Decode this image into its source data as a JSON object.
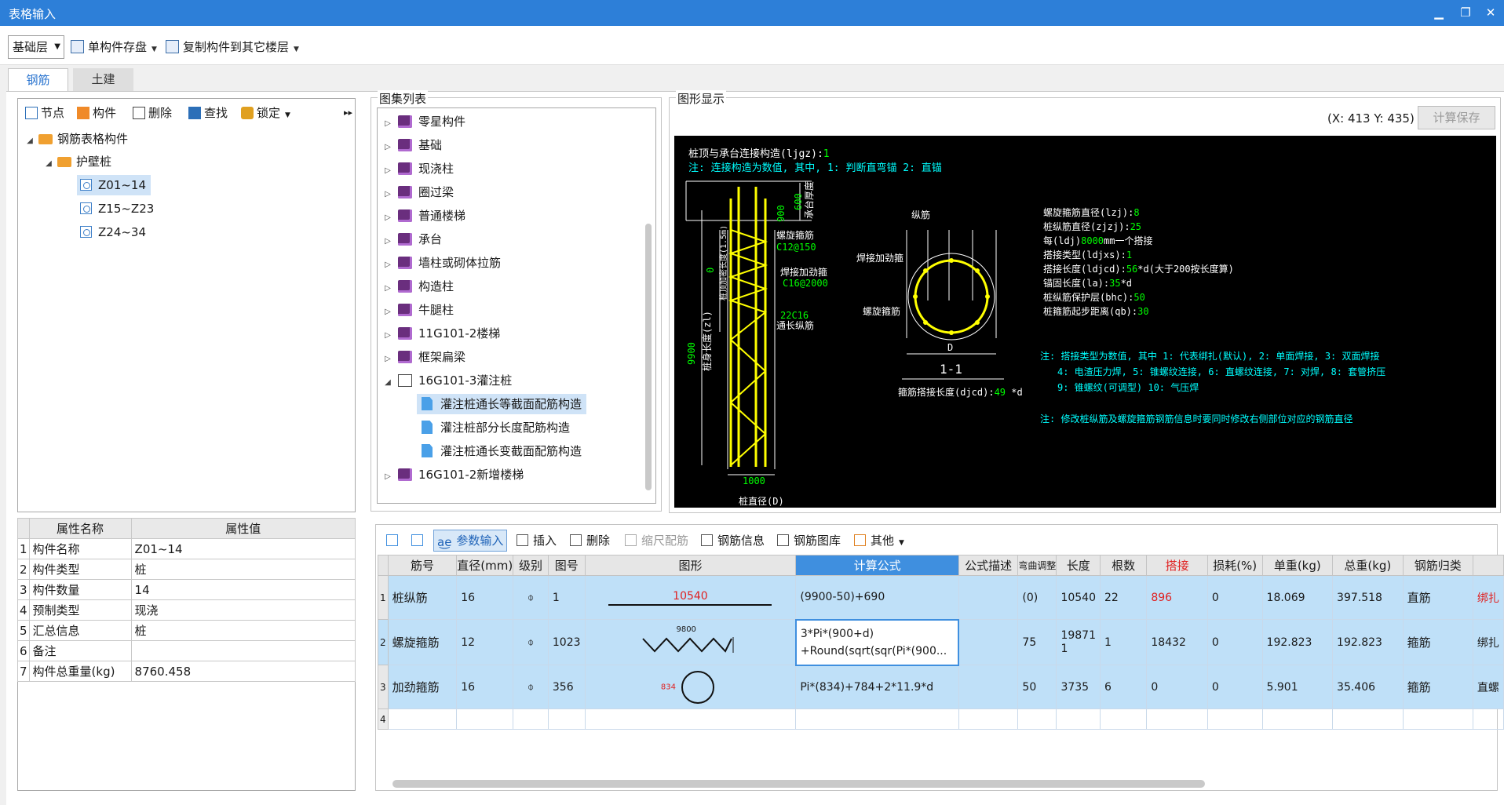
{
  "window": {
    "title": "表格输入"
  },
  "toolbar": {
    "floor": "基础层",
    "save_single": "单构件存盘",
    "copy_to_floor": "复制构件到其它楼层"
  },
  "tabs": [
    "钢筋",
    "土建"
  ],
  "left_toolbar": [
    "节点",
    "构件",
    "删除",
    "查找",
    "锁定"
  ],
  "tree": {
    "root": "钢筋表格构件",
    "group": "护壁桩",
    "items": [
      "Z01~14",
      "Z15~Z23",
      "Z24~34"
    ]
  },
  "props": {
    "headers": [
      "属性名称",
      "属性值"
    ],
    "rows": [
      {
        "n": "1",
        "k": "构件名称",
        "v": "Z01~14"
      },
      {
        "n": "2",
        "k": "构件类型",
        "v": "桩"
      },
      {
        "n": "3",
        "k": "构件数量",
        "v": "14"
      },
      {
        "n": "4",
        "k": "预制类型",
        "v": "现浇"
      },
      {
        "n": "5",
        "k": "汇总信息",
        "v": "桩"
      },
      {
        "n": "6",
        "k": "备注",
        "v": ""
      },
      {
        "n": "7",
        "k": "构件总重量(kg)",
        "v": "8760.458"
      }
    ]
  },
  "atlas": {
    "title": "图集列表",
    "items": [
      "零星构件",
      "基础",
      "现浇柱",
      "圈过梁",
      "普通楼梯",
      "承台",
      "墙柱或砌体拉筋",
      "构造柱",
      "牛腿柱",
      "11G101-2楼梯",
      "框架扁梁",
      "16G101-3灌注桩"
    ],
    "children": [
      "灌注桩通长等截面配筋构造",
      "灌注桩部分长度配筋构造",
      "灌注桩通长变截面配筋构造"
    ],
    "last": "16G101-2新增楼梯"
  },
  "graphic": {
    "title": "图形显示",
    "coord": "(X: 413 Y: 435)",
    "calc_save": "计算保存"
  },
  "cad": {
    "top1": "桩顶与承台连接构造(ljgz):",
    "top1v": "1",
    "top2": "注: 连接构造为数值, 其中, 1: 判断直弯锚     2: 直锚",
    "l_spiral": "螺旋箍筋",
    "l_spiral_v": "C12@150",
    "l_add": "焊接加劲箍",
    "l_add_v": "C16@2000",
    "l_long_v": "22C16",
    "l_long": "通长纵筋",
    "h9900": "9900",
    "len_label": "桩身长度(zl)",
    "top_len": "桩顶加密长度(1.5m)",
    "zero": "0",
    "d900": "900",
    "d600": "600",
    "cap": "承台厚度",
    "w1000": "1000",
    "dia": "桩直径(D)",
    "sec_long": "纵筋",
    "sec_add": "焊接加劲箍",
    "sec_sp": "螺旋箍筋",
    "sec_D": "D",
    "sec_title": "1-1",
    "lap": "箍筋搭接长度(djcd):",
    "lap_v": "49",
    "lap_u": "*d",
    "p": [
      [
        "螺旋箍筋直径(lzj):",
        "8",
        ""
      ],
      [
        "桩纵筋直径(zjzj):",
        "25",
        ""
      ],
      [
        "每(ldj)",
        "8000",
        "mm一个搭接"
      ],
      [
        "搭接类型(ldjxs):",
        "1",
        ""
      ],
      [
        "搭接长度(ldjcd):",
        "56",
        "*d(大于200按长度算)"
      ],
      [
        "锚固长度(la):",
        "35",
        "*d"
      ],
      [
        "桩纵筋保护层(bhc):",
        "50",
        ""
      ],
      [
        "桩箍筋起步距离(qb):",
        "30",
        ""
      ]
    ],
    "n1": "注: 搭接类型为数值, 其中 1: 代表绑扎(默认), 2: 单面焊接, 3: 双面焊接",
    "n2": "4: 电渣压力焊, 5: 锥螺纹连接, 6: 直螺纹连接, 7: 对焊, 8: 套管挤压",
    "n3": "9: 锥螺纹(可调型)  10: 气压焊",
    "n4": "注: 修改桩纵筋及螺旋箍筋钢筋信息时要同时修改右侧部位对应的钢筋直径"
  },
  "grid_toolbar": [
    "参数输入",
    "插入",
    "删除",
    "缩尺配筋",
    "钢筋信息",
    "钢筋图库",
    "其他"
  ],
  "grid": {
    "headers": [
      "筋号",
      "直径(mm)",
      "级别",
      "图号",
      "图形",
      "计算公式",
      "公式描述",
      "弯曲调整",
      "长度",
      "根数",
      "搭接",
      "损耗(%)",
      "单重(kg)",
      "总重(kg)",
      "钢筋归类",
      ""
    ],
    "rows": [
      {
        "n": "1",
        "name": "桩纵筋",
        "d": "16",
        "grade": "⌽",
        "fig": "1",
        "shape": "10540",
        "f1": "(9900-50)+690",
        "f2": "",
        "desc": "",
        "bend": "(0)",
        "len": "10540",
        "cnt": "22",
        "lap": "896",
        "loss": "0",
        "uw": "18.069",
        "tw": "397.518",
        "cls": "直筋",
        "type": "绑扎"
      },
      {
        "n": "2",
        "name": "螺旋箍筋",
        "d": "12",
        "grade": "⌽",
        "fig": "1023",
        "shape": "9800",
        "f1": "3*Pi*(900+d)",
        "f2": "+Round(sqrt(sqr(Pi*(900...",
        "desc": "",
        "bend": "75",
        "len": "198711",
        "cnt": "1",
        "lap": "18432",
        "loss": "0",
        "uw": "192.823",
        "tw": "192.823",
        "cls": "箍筋",
        "type": "绑扎"
      },
      {
        "n": "3",
        "name": "加劲箍筋",
        "d": "16",
        "grade": "⌽",
        "fig": "356",
        "shape": "834",
        "f1": "Pi*(834)+784+2*11.9*d",
        "f2": "",
        "desc": "",
        "bend": "50",
        "len": "3735",
        "cnt": "6",
        "lap": "0",
        "loss": "0",
        "uw": "5.901",
        "tw": "35.406",
        "cls": "箍筋",
        "type": "直螺"
      },
      {
        "n": "4",
        "name": "",
        "d": "",
        "grade": "",
        "fig": "",
        "shape": "",
        "f1": "",
        "f2": "",
        "desc": "",
        "bend": "",
        "len": "",
        "cnt": "",
        "lap": "",
        "loss": "",
        "uw": "",
        "tw": "",
        "cls": "",
        "type": ""
      }
    ]
  },
  "colors": {
    "title_blue": "#2d7fd8",
    "selected": "#bfe0f8",
    "header_hl": "#3f8fdf",
    "cad_bg": "#000000",
    "cad_yellow": "#ffff00",
    "cad_green": "#00ff00",
    "cad_cyan": "#00ffff"
  }
}
